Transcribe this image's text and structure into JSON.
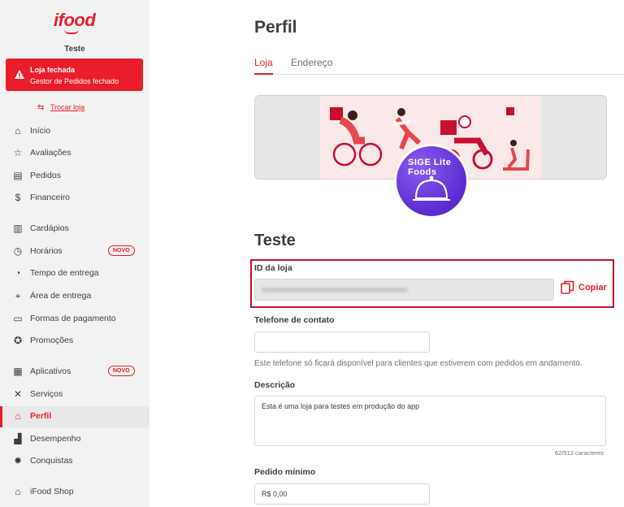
{
  "brand": {
    "logo": "ifood",
    "accent": "#ea1d2c"
  },
  "sidebar": {
    "store_name": "Teste",
    "alert": {
      "title": "Loja fechada",
      "subtitle": "Gestor de Pedidos fechado"
    },
    "switch_store": "Trocar loja",
    "items": [
      {
        "label": "Início",
        "icon": "home-icon"
      },
      {
        "label": "Avaliações",
        "icon": "star-icon"
      },
      {
        "label": "Pedidos",
        "icon": "receipt-icon"
      },
      {
        "label": "Financeiro",
        "icon": "dollar-icon"
      },
      {
        "label": "Cardápios",
        "icon": "menu-book-icon"
      },
      {
        "label": "Horários",
        "icon": "clock-icon",
        "badge": "NOVO"
      },
      {
        "label": "Tempo de entrega",
        "icon": "timer-icon"
      },
      {
        "label": "Área de entrega",
        "icon": "map-pin-icon"
      },
      {
        "label": "Formas de pagamento",
        "icon": "card-icon"
      },
      {
        "label": "Promoções",
        "icon": "promo-icon"
      },
      {
        "label": "Aplicativos",
        "icon": "apps-icon",
        "badge": "NOVO"
      },
      {
        "label": "Serviços",
        "icon": "tools-icon"
      },
      {
        "label": "Perfil",
        "icon": "store-icon",
        "active": true
      },
      {
        "label": "Desempenho",
        "icon": "chart-icon"
      },
      {
        "label": "Conquistas",
        "icon": "medal-icon"
      },
      {
        "label": "iFood Shop",
        "icon": "shop-bag-icon"
      }
    ]
  },
  "main": {
    "title": "Perfil",
    "tabs": [
      "Loja",
      "Endereço"
    ],
    "store_title": "Teste",
    "avatar_text": "SIGE Lite Foods",
    "id_label": "ID da loja",
    "copy_label": "Copiar",
    "phone_label": "Telefone de contato",
    "phone_hint": "Este telefone só ficará disponível para clientes que estiverem com pedidos em andamento.",
    "description_label": "Descrição",
    "description_value": "Esta é uma loja para testes em produção do app",
    "description_counter": "62/512 caracteres",
    "min_order_label": "Pedido mínimo",
    "min_order_value": "R$ 0,00"
  }
}
